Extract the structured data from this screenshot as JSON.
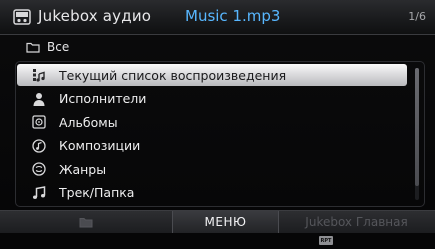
{
  "header": {
    "title": "Jukebox аудио",
    "track": "Music 1.mp3",
    "page_counter": "1/6",
    "icon": "jukebox-icon"
  },
  "folder": {
    "label": "Все",
    "icon": "folder-icon"
  },
  "menu": {
    "items": [
      {
        "label": "Текущий список воспроизведения",
        "icon": "now-playing-list-icon",
        "selected": true
      },
      {
        "label": "Исполнители",
        "icon": "artist-icon",
        "selected": false
      },
      {
        "label": "Альбомы",
        "icon": "album-icon",
        "selected": false
      },
      {
        "label": "Композиции",
        "icon": "song-icon",
        "selected": false
      },
      {
        "label": "Жанры",
        "icon": "genre-icon",
        "selected": false
      },
      {
        "label": "Трек/Папка",
        "icon": "music-note-icon",
        "selected": false
      }
    ]
  },
  "tabs": {
    "menu_label": "МЕНЮ",
    "main_label": "Jukebox Главная",
    "folder_icon": "folder-icon"
  },
  "status": {
    "repeat_badge": "RPT"
  },
  "colors": {
    "accent": "#58b7ff",
    "selected_bg": "#dcdcde",
    "text": "#eeeeef"
  }
}
